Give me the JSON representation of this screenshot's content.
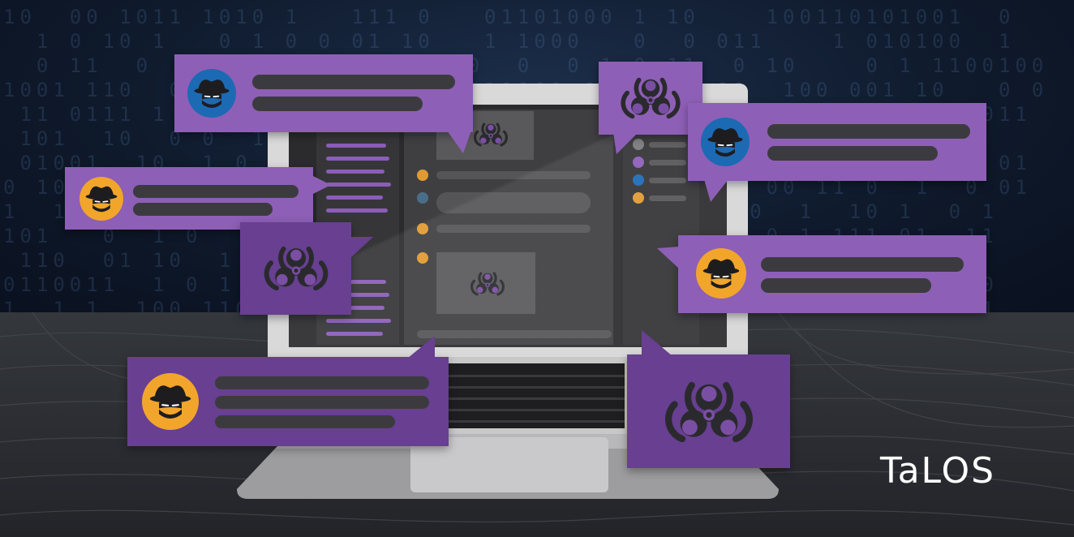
{
  "brand": {
    "logo_text": "TaLOS"
  },
  "background": {
    "binary_rows": [
      "10  00 1011 1010 1   111 0   01101000 1 10    100110101001  0",
      "  1 0 10 1   0 1 0 0 01 10   1 1000   0  0 011    1 010100  1",
      "  0 11  0     1    11  0 0110  0  0 1 0 11  0 10    0 1 1100100",
      "1001 110  01 10 1  1 0   1   11001 00    0 01  100 001 10   0 0",
      " 11 0111 1 0  1  0  1  0  0 1  1 0  1 01   0  11 1  10  1  011",
      " 101  10  0 0  1 10  1  0 0  1 10  0    1 0  1 1  0   1 0 1",
      " 01001  10  1 0  01 1  0  1  01 10  1 0  0 11   01  0 1  11 01",
      "0 10 10  10 1011   0  1 0 0 11  0  01  1 10 1 00 11 0  1  0 01",
      "1  100 0 11  0  1 1  0   1  10 0 1  1 00 1 1 0  1  10 1  0 1",
      "101   0  1 0   10 1 10  0 1  0  1  1 0 11 0 1 0 1 111 01  11",
      " 110  01 10  1  0  0 1  10 0  1 1 0  0 1  1 0 01 10  1 1  0",
      "0110011  1 0 1  0 1 0  1  0 1 0  1 1 0 1 10  0  1 01  1 0 10",
      "1  1 1  100 110  1 0  1 1  0  1 0 0 1  1 0 1  0 1  1 0 1 011"
    ]
  },
  "colors": {
    "bubble_light": "#8e5fb6",
    "bubble_dark": "#683f91",
    "avatar_blue": "#1c6ab4",
    "avatar_orange": "#f2a52b",
    "line": "#3b3b3f"
  },
  "bubbles": [
    {
      "kind": "message",
      "avatar": "spy-blue"
    },
    {
      "kind": "icon",
      "icon": "biohazard-icon"
    },
    {
      "kind": "message",
      "avatar": "spy-blue"
    },
    {
      "kind": "message",
      "avatar": "spy-orange"
    },
    {
      "kind": "icon",
      "icon": "biohazard-icon"
    },
    {
      "kind": "message",
      "avatar": "spy-orange"
    },
    {
      "kind": "message",
      "avatar": "spy-orange"
    },
    {
      "kind": "icon",
      "icon": "biohazard-icon"
    }
  ]
}
